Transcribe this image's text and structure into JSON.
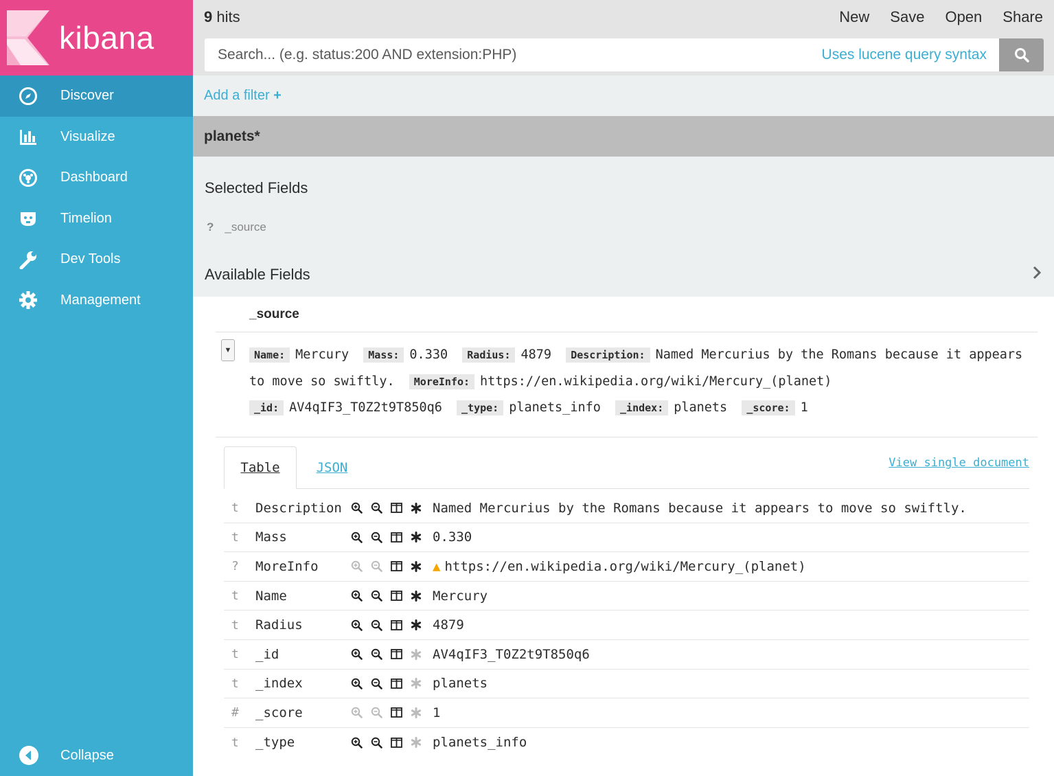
{
  "app": {
    "brand": "kibana"
  },
  "sidebar": {
    "items": [
      {
        "label": "Discover",
        "icon": "compass-icon"
      },
      {
        "label": "Visualize",
        "icon": "bar-chart-icon"
      },
      {
        "label": "Dashboard",
        "icon": "dashboard-icon"
      },
      {
        "label": "Timelion",
        "icon": "timelion-icon"
      },
      {
        "label": "Dev Tools",
        "icon": "wrench-icon"
      },
      {
        "label": "Management",
        "icon": "gear-icon"
      }
    ],
    "collapse_label": "Collapse"
  },
  "topbar": {
    "hits_count": "9",
    "hits_label": " hits",
    "new_label": "New",
    "save_label": "Save",
    "open_label": "Open",
    "share_label": "Share"
  },
  "search": {
    "placeholder": "Search... (e.g. status:200 AND extension:PHP)",
    "syntax_link": "Uses lucene query syntax"
  },
  "filter": {
    "add_label": "Add a filter",
    "add_icon": "+"
  },
  "index_pattern": "planets*",
  "fields": {
    "selected_title": "Selected Fields",
    "selected_item_type": "?",
    "selected_item": "_source",
    "available_title": "Available Fields"
  },
  "doc": {
    "column_header": "_source",
    "summary": [
      {
        "k": "Name:",
        "v": "Mercury"
      },
      {
        "k": "Mass:",
        "v": "0.330"
      },
      {
        "k": "Radius:",
        "v": "4879"
      },
      {
        "k": "Description:",
        "v": "Named Mercurius by the Romans because it appears to move so swiftly."
      },
      {
        "k": "MoreInfo:",
        "v": "https://en.wikipedia.org/wiki/Mercury_(planet)"
      },
      {
        "k": "_id:",
        "v": "AV4qIF3_T0Z2t9T850q6"
      },
      {
        "k": "_type:",
        "v": "planets_info"
      },
      {
        "k": "_index:",
        "v": "planets"
      },
      {
        "k": "_score:",
        "v": "1"
      }
    ],
    "tabs": {
      "table": "Table",
      "json": "JSON"
    },
    "view_single": "View single document",
    "rows": [
      {
        "type": "t",
        "field": "Description",
        "value": "Named Mercurius by the Romans because it appears to move so swiftly.",
        "filter_enabled": true,
        "exists_dim": false,
        "warn": false
      },
      {
        "type": "t",
        "field": "Mass",
        "value": "0.330",
        "filter_enabled": true,
        "exists_dim": false,
        "warn": false
      },
      {
        "type": "?",
        "field": "MoreInfo",
        "value": "https://en.wikipedia.org/wiki/Mercury_(planet)",
        "filter_enabled": false,
        "exists_dim": false,
        "warn": true
      },
      {
        "type": "t",
        "field": "Name",
        "value": "Mercury",
        "filter_enabled": true,
        "exists_dim": false,
        "warn": false
      },
      {
        "type": "t",
        "field": "Radius",
        "value": "4879",
        "filter_enabled": true,
        "exists_dim": false,
        "warn": false
      },
      {
        "type": "t",
        "field": "_id",
        "value": "AV4qIF3_T0Z2t9T850q6",
        "filter_enabled": true,
        "exists_dim": true,
        "warn": false
      },
      {
        "type": "t",
        "field": "_index",
        "value": "planets",
        "filter_enabled": true,
        "exists_dim": true,
        "warn": false
      },
      {
        "type": "#",
        "field": "_score",
        "value": "1",
        "filter_enabled": false,
        "exists_dim": true,
        "warn": false
      },
      {
        "type": "t",
        "field": "_type",
        "value": "planets_info",
        "filter_enabled": true,
        "exists_dim": true,
        "warn": false
      }
    ]
  },
  "colors": {
    "brand_pink": "#e8488b",
    "sidebar_blue": "#3caed2",
    "active_blue": "#2f97bf",
    "link_blue": "#3caed2",
    "warning": "#f5a700"
  }
}
